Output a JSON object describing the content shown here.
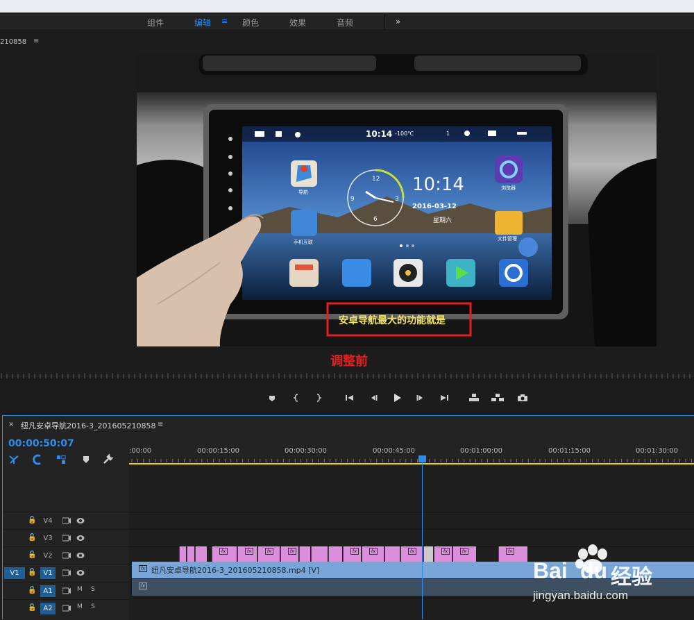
{
  "workspace": {
    "tabs": [
      {
        "label": "组件"
      },
      {
        "label": "编辑"
      },
      {
        "label": "颜色"
      },
      {
        "label": "效果"
      },
      {
        "label": "音频"
      }
    ],
    "menu_glyph": "≡",
    "overflow_glyph": "»"
  },
  "monitor": {
    "title": "210858",
    "menu_glyph": "≡",
    "annotation": "调整前",
    "video": {
      "time": "10:14",
      "temperature": "-100℃",
      "volume_level": "1",
      "clock_big": "10:14",
      "date": "2016-03-12",
      "weekday": "星期六",
      "caption": "安卓导航最大的功能就是",
      "app_nav": "导航",
      "app_phone_link": "手机互联",
      "app_browser": "浏览器",
      "app_files": "文件管理",
      "clock_numbers": [
        "12",
        "3",
        "6",
        "9"
      ]
    }
  },
  "transport": {
    "buttons": [
      "marker",
      "mark-in",
      "mark-out",
      "go-to-in",
      "step-back",
      "play",
      "step-forward",
      "go-to-out",
      "lift",
      "extract",
      "export-frame"
    ]
  },
  "timeline": {
    "close_glyph": "×",
    "sequence_name": "纽凡安卓导航2016-3_201605210858",
    "menu_glyph": "≡",
    "timecode": "00:00:50:07",
    "ruler_labels": [
      ":00:00",
      "00:00:15:00",
      "00:00:30:00",
      "00:00:45:00",
      "00:01:00:00",
      "00:01:15:00",
      "00:01:30:00"
    ],
    "tracks": [
      {
        "name": "V4",
        "type": "video"
      },
      {
        "name": "V3",
        "type": "video"
      },
      {
        "name": "V2",
        "type": "video"
      },
      {
        "name": "V1",
        "type": "video",
        "source": "V1"
      },
      {
        "name": "A1",
        "type": "audio"
      },
      {
        "name": "A2",
        "type": "audio"
      }
    ],
    "audio_mute": "M",
    "audio_solo": "S",
    "fx_label": "fx",
    "v1_clip_label": "纽凡安卓导航2016-3_201605210858.mp4 [V]",
    "colors": {
      "accent": "#2d8ceb",
      "v2_clip": "#d98fd9",
      "v1_clip": "#79a6d6",
      "a1_clip": "#3e4f62",
      "work_area": "#e8d21a"
    }
  },
  "watermark": {
    "brand": "Bai",
    "brand_suffix": "du",
    "cn": "经验",
    "url": "jingyan.baidu.com"
  }
}
